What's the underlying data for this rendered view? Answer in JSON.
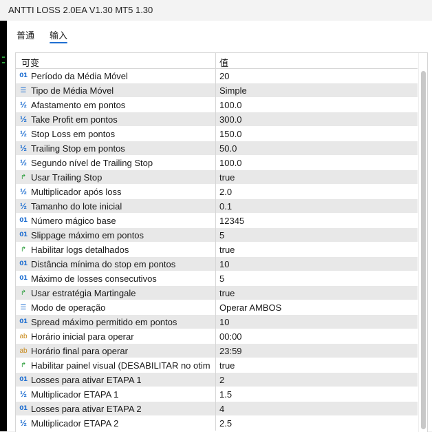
{
  "window": {
    "title": "ANTTI LOSS 2.0EA V1.30 MT5 1.30"
  },
  "tabs": [
    {
      "label": "普通"
    },
    {
      "label": "输入"
    }
  ],
  "grid": {
    "col_variable": "可变",
    "col_value": "值",
    "rows": [
      {
        "type": "int",
        "name": "Período da Média Móvel",
        "value": "20"
      },
      {
        "type": "enum",
        "name": "Tipo de Média Móvel",
        "value": "Simple"
      },
      {
        "type": "dbl",
        "name": "Afastamento em pontos",
        "value": "100.0"
      },
      {
        "type": "dbl",
        "name": "Take Profit em pontos",
        "value": "300.0"
      },
      {
        "type": "dbl",
        "name": "Stop Loss em pontos",
        "value": "150.0"
      },
      {
        "type": "dbl",
        "name": "Trailing Stop em pontos",
        "value": "50.0"
      },
      {
        "type": "dbl",
        "name": "Segundo nível de Trailing Stop",
        "value": "100.0"
      },
      {
        "type": "bool",
        "name": "Usar Trailing Stop",
        "value": "true"
      },
      {
        "type": "dbl",
        "name": "Multiplicador após loss",
        "value": "2.0"
      },
      {
        "type": "dbl",
        "name": "Tamanho do lote inicial",
        "value": "0.1"
      },
      {
        "type": "int",
        "name": "Número mágico base",
        "value": "12345"
      },
      {
        "type": "int",
        "name": "Slippage máximo em pontos",
        "value": "5"
      },
      {
        "type": "bool",
        "name": "Habilitar logs detalhados",
        "value": "true"
      },
      {
        "type": "int",
        "name": "Distância mínima do stop em pontos",
        "value": "10"
      },
      {
        "type": "int",
        "name": "Máximo de losses consecutivos",
        "value": "5"
      },
      {
        "type": "bool",
        "name": "Usar estratégia Martingale",
        "value": "true"
      },
      {
        "type": "enum",
        "name": "Modo de operação",
        "value": "Operar AMBOS"
      },
      {
        "type": "int",
        "name": "Spread máximo permitido em pontos",
        "value": "10"
      },
      {
        "type": "str",
        "name": "Horário inicial para operar",
        "value": "00:00"
      },
      {
        "type": "str",
        "name": "Horário final para operar",
        "value": "23:59"
      },
      {
        "type": "bool",
        "name": "Habilitar painel visual (DESABILITAR no otim…",
        "value": "true"
      },
      {
        "type": "int",
        "name": "Losses para ativar ETAPA 1",
        "value": "2"
      },
      {
        "type": "dbl",
        "name": "Multiplicador ETAPA 1",
        "value": "1.5"
      },
      {
        "type": "int",
        "name": "Losses para ativar ETAPA 2",
        "value": "4"
      },
      {
        "type": "dbl",
        "name": "Multiplicador ETAPA 2",
        "value": "2.5"
      }
    ]
  },
  "icons": {
    "int": {
      "name": "integer-type-icon",
      "glyph": "01"
    },
    "dbl": {
      "name": "double-type-icon",
      "glyph": "½"
    },
    "enum": {
      "name": "enum-type-icon",
      "glyph": "☰"
    },
    "bool": {
      "name": "boolean-type-icon",
      "glyph": "↱"
    },
    "str": {
      "name": "string-type-icon",
      "glyph": "ab"
    }
  },
  "colors": {
    "accent": "#1f6fd1",
    "row_alt": "#e8e8e8",
    "bool_icon": "#2a9d3a",
    "string_icon": "#c98a1b"
  }
}
